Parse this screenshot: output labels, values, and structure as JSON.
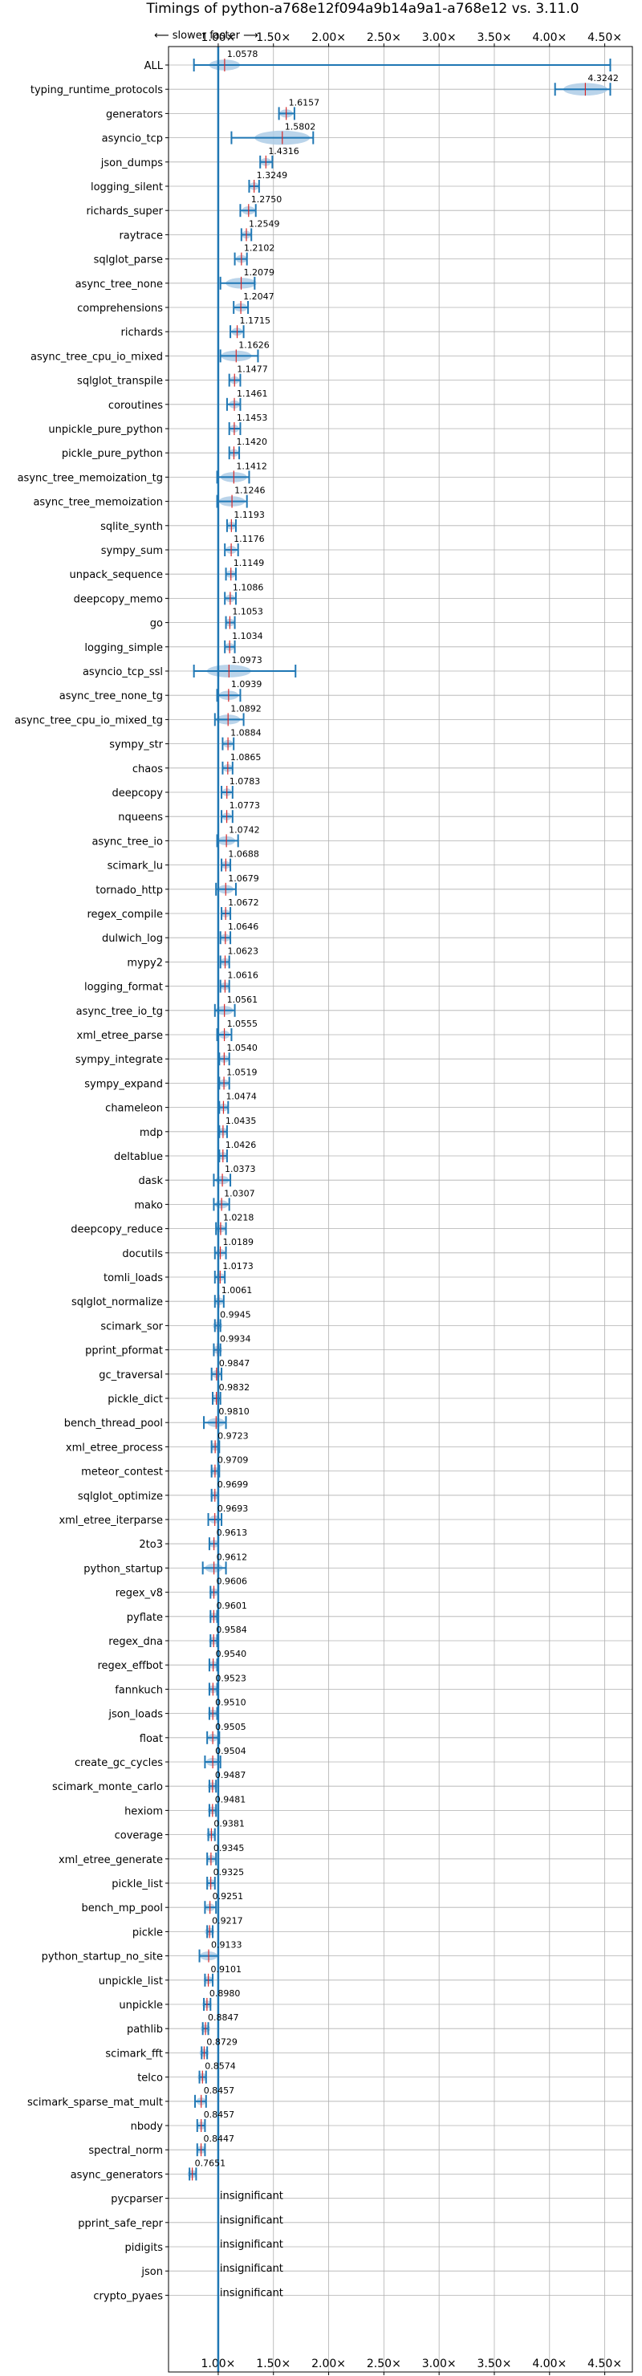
{
  "chart_data": {
    "type": "scatter",
    "title": "Timings of python-a768e12f094a9b14a9a1-a768e12 vs. 3.11.0",
    "direction_label": "⟵ slower    faster ⟶",
    "insignificant_label": "insignificant",
    "xlim": [
      0.55,
      4.75
    ],
    "x_ticks": [
      {
        "v": 1.0,
        "label": "1.00×"
      },
      {
        "v": 1.5,
        "label": "1.50×"
      },
      {
        "v": 2.0,
        "label": "2.00×"
      },
      {
        "v": 2.5,
        "label": "2.50×"
      },
      {
        "v": 3.0,
        "label": "3.00×"
      },
      {
        "v": 3.5,
        "label": "3.50×"
      },
      {
        "v": 4.0,
        "label": "4.00×"
      },
      {
        "v": 4.5,
        "label": "4.50×"
      }
    ],
    "reference_line": 1.0,
    "grid": true,
    "colors": {
      "marker": "#1f77b4",
      "violin": "#aecde6",
      "median": "#d62728",
      "grid": "#b0b0b0",
      "axis": "#000000"
    },
    "benchmarks": [
      {
        "name": "ALL",
        "value": 1.0578,
        "label": "1.0578",
        "lo": 0.78,
        "hi": 4.55,
        "w": 0.14
      },
      {
        "name": "typing_runtime_protocols",
        "value": 4.3242,
        "label": "4.3242",
        "lo": 4.05,
        "hi": 4.55,
        "w": 0.2
      },
      {
        "name": "generators",
        "value": 1.6157,
        "label": "1.6157",
        "lo": 1.55,
        "hi": 1.69,
        "w": 0.06
      },
      {
        "name": "asyncio_tcp",
        "value": 1.5802,
        "label": "1.5802",
        "lo": 1.12,
        "hi": 1.86,
        "w": 0.25
      },
      {
        "name": "json_dumps",
        "value": 1.4316,
        "label": "1.4316",
        "lo": 1.38,
        "hi": 1.49,
        "w": 0.05
      },
      {
        "name": "logging_silent",
        "value": 1.3249,
        "label": "1.3249",
        "lo": 1.28,
        "hi": 1.37,
        "w": 0.04
      },
      {
        "name": "richards_super",
        "value": 1.275,
        "label": "1.2750",
        "lo": 1.2,
        "hi": 1.34,
        "w": 0.06
      },
      {
        "name": "raytrace",
        "value": 1.2549,
        "label": "1.2549",
        "lo": 1.21,
        "hi": 1.3,
        "w": 0.04
      },
      {
        "name": "sqlglot_parse",
        "value": 1.2102,
        "label": "1.2102",
        "lo": 1.15,
        "hi": 1.26,
        "w": 0.05
      },
      {
        "name": "async_tree_none",
        "value": 1.2079,
        "label": "1.2079",
        "lo": 1.02,
        "hi": 1.33,
        "w": 0.14
      },
      {
        "name": "comprehensions",
        "value": 1.2047,
        "label": "1.2047",
        "lo": 1.14,
        "hi": 1.27,
        "w": 0.06
      },
      {
        "name": "richards",
        "value": 1.1715,
        "label": "1.1715",
        "lo": 1.11,
        "hi": 1.23,
        "w": 0.05
      },
      {
        "name": "async_tree_cpu_io_mixed",
        "value": 1.1626,
        "label": "1.1626",
        "lo": 1.02,
        "hi": 1.36,
        "w": 0.14
      },
      {
        "name": "sqlglot_transpile",
        "value": 1.1477,
        "label": "1.1477",
        "lo": 1.1,
        "hi": 1.2,
        "w": 0.04
      },
      {
        "name": "coroutines",
        "value": 1.1461,
        "label": "1.1461",
        "lo": 1.08,
        "hi": 1.2,
        "w": 0.05
      },
      {
        "name": "unpickle_pure_python",
        "value": 1.1453,
        "label": "1.1453",
        "lo": 1.1,
        "hi": 1.2,
        "w": 0.04
      },
      {
        "name": "pickle_pure_python",
        "value": 1.142,
        "label": "1.1420",
        "lo": 1.1,
        "hi": 1.19,
        "w": 0.04
      },
      {
        "name": "async_tree_memoization_tg",
        "value": 1.1412,
        "label": "1.1412",
        "lo": 0.99,
        "hi": 1.28,
        "w": 0.12
      },
      {
        "name": "async_tree_memoization",
        "value": 1.1246,
        "label": "1.1246",
        "lo": 0.99,
        "hi": 1.26,
        "w": 0.12
      },
      {
        "name": "sqlite_synth",
        "value": 1.1193,
        "label": "1.1193",
        "lo": 1.08,
        "hi": 1.16,
        "w": 0.035
      },
      {
        "name": "sympy_sum",
        "value": 1.1176,
        "label": "1.1176",
        "lo": 1.06,
        "hi": 1.18,
        "w": 0.05
      },
      {
        "name": "unpack_sequence",
        "value": 1.1149,
        "label": "1.1149",
        "lo": 1.07,
        "hi": 1.16,
        "w": 0.04
      },
      {
        "name": "deepcopy_memo",
        "value": 1.1086,
        "label": "1.1086",
        "lo": 1.06,
        "hi": 1.16,
        "w": 0.04
      },
      {
        "name": "go",
        "value": 1.1053,
        "label": "1.1053",
        "lo": 1.07,
        "hi": 1.15,
        "w": 0.035
      },
      {
        "name": "logging_simple",
        "value": 1.1034,
        "label": "1.1034",
        "lo": 1.06,
        "hi": 1.15,
        "w": 0.04
      },
      {
        "name": "asyncio_tcp_ssl",
        "value": 1.0973,
        "label": "1.0973",
        "lo": 0.78,
        "hi": 1.7,
        "w": 0.2
      },
      {
        "name": "async_tree_none_tg",
        "value": 1.0939,
        "label": "1.0939",
        "lo": 0.99,
        "hi": 1.2,
        "w": 0.09
      },
      {
        "name": "async_tree_cpu_io_mixed_tg",
        "value": 1.0892,
        "label": "1.0892",
        "lo": 0.97,
        "hi": 1.23,
        "w": 0.11
      },
      {
        "name": "sympy_str",
        "value": 1.0884,
        "label": "1.0884",
        "lo": 1.04,
        "hi": 1.14,
        "w": 0.04
      },
      {
        "name": "chaos",
        "value": 1.0865,
        "label": "1.0865",
        "lo": 1.04,
        "hi": 1.13,
        "w": 0.04
      },
      {
        "name": "deepcopy",
        "value": 1.0783,
        "label": "1.0783",
        "lo": 1.03,
        "hi": 1.13,
        "w": 0.04
      },
      {
        "name": "nqueens",
        "value": 1.0773,
        "label": "1.0773",
        "lo": 1.03,
        "hi": 1.13,
        "w": 0.04
      },
      {
        "name": "async_tree_io",
        "value": 1.0742,
        "label": "1.0742",
        "lo": 0.99,
        "hi": 1.18,
        "w": 0.08
      },
      {
        "name": "scimark_lu",
        "value": 1.0688,
        "label": "1.0688",
        "lo": 1.03,
        "hi": 1.11,
        "w": 0.035
      },
      {
        "name": "tornado_http",
        "value": 1.0679,
        "label": "1.0679",
        "lo": 0.98,
        "hi": 1.16,
        "w": 0.07
      },
      {
        "name": "regex_compile",
        "value": 1.0672,
        "label": "1.0672",
        "lo": 1.03,
        "hi": 1.11,
        "w": 0.035
      },
      {
        "name": "dulwich_log",
        "value": 1.0646,
        "label": "1.0646",
        "lo": 1.02,
        "hi": 1.11,
        "w": 0.035
      },
      {
        "name": "mypy2",
        "value": 1.0623,
        "label": "1.0623",
        "lo": 1.02,
        "hi": 1.1,
        "w": 0.035
      },
      {
        "name": "logging_format",
        "value": 1.0616,
        "label": "1.0616",
        "lo": 1.02,
        "hi": 1.1,
        "w": 0.035
      },
      {
        "name": "async_tree_io_tg",
        "value": 1.0561,
        "label": "1.0561",
        "lo": 0.97,
        "hi": 1.15,
        "w": 0.08
      },
      {
        "name": "xml_etree_parse",
        "value": 1.0555,
        "label": "1.0555",
        "lo": 0.99,
        "hi": 1.12,
        "w": 0.05
      },
      {
        "name": "sympy_integrate",
        "value": 1.054,
        "label": "1.0540",
        "lo": 1.01,
        "hi": 1.1,
        "w": 0.035
      },
      {
        "name": "sympy_expand",
        "value": 1.0519,
        "label": "1.0519",
        "lo": 1.01,
        "hi": 1.1,
        "w": 0.035
      },
      {
        "name": "chameleon",
        "value": 1.0474,
        "label": "1.0474",
        "lo": 1.01,
        "hi": 1.09,
        "w": 0.035
      },
      {
        "name": "mdp",
        "value": 1.0435,
        "label": "1.0435",
        "lo": 1.01,
        "hi": 1.08,
        "w": 0.03
      },
      {
        "name": "deltablue",
        "value": 1.0426,
        "label": "1.0426",
        "lo": 1.01,
        "hi": 1.08,
        "w": 0.03
      },
      {
        "name": "dask",
        "value": 1.0373,
        "label": "1.0373",
        "lo": 0.96,
        "hi": 1.11,
        "w": 0.06
      },
      {
        "name": "mako",
        "value": 1.0307,
        "label": "1.0307",
        "lo": 0.96,
        "hi": 1.1,
        "w": 0.06
      },
      {
        "name": "deepcopy_reduce",
        "value": 1.0218,
        "label": "1.0218",
        "lo": 0.98,
        "hi": 1.07,
        "w": 0.035
      },
      {
        "name": "docutils",
        "value": 1.0189,
        "label": "1.0189",
        "lo": 0.97,
        "hi": 1.07,
        "w": 0.04
      },
      {
        "name": "tomli_loads",
        "value": 1.0173,
        "label": "1.0173",
        "lo": 0.97,
        "hi": 1.06,
        "w": 0.035
      },
      {
        "name": "sqlglot_normalize",
        "value": 1.0061,
        "label": "1.0061",
        "lo": 0.97,
        "hi": 1.05,
        "w": 0.03
      },
      {
        "name": "scimark_sor",
        "value": 0.9945,
        "label": "0.9945",
        "lo": 0.97,
        "hi": 1.02,
        "w": 0.025
      },
      {
        "name": "pprint_pformat",
        "value": 0.9934,
        "label": "0.9934",
        "lo": 0.96,
        "hi": 1.02,
        "w": 0.025
      },
      {
        "name": "gc_traversal",
        "value": 0.9847,
        "label": "0.9847",
        "lo": 0.94,
        "hi": 1.03,
        "w": 0.04
      },
      {
        "name": "pickle_dict",
        "value": 0.9832,
        "label": "0.9832",
        "lo": 0.95,
        "hi": 1.02,
        "w": 0.025
      },
      {
        "name": "bench_thread_pool",
        "value": 0.981,
        "label": "0.9810",
        "lo": 0.87,
        "hi": 1.07,
        "w": 0.08
      },
      {
        "name": "xml_etree_process",
        "value": 0.9723,
        "label": "0.9723",
        "lo": 0.94,
        "hi": 1.01,
        "w": 0.03
      },
      {
        "name": "meteor_contest",
        "value": 0.9709,
        "label": "0.9709",
        "lo": 0.94,
        "hi": 1.01,
        "w": 0.03
      },
      {
        "name": "sqlglot_optimize",
        "value": 0.9699,
        "label": "0.9699",
        "lo": 0.94,
        "hi": 1.0,
        "w": 0.025
      },
      {
        "name": "xml_etree_iterparse",
        "value": 0.9693,
        "label": "0.9693",
        "lo": 0.91,
        "hi": 1.03,
        "w": 0.05
      },
      {
        "name": "2to3",
        "value": 0.9613,
        "label": "0.9613",
        "lo": 0.92,
        "hi": 1.0,
        "w": 0.03
      },
      {
        "name": "python_startup",
        "value": 0.9612,
        "label": "0.9612",
        "lo": 0.86,
        "hi": 1.07,
        "w": 0.08
      },
      {
        "name": "regex_v8",
        "value": 0.9606,
        "label": "0.9606",
        "lo": 0.93,
        "hi": 1.0,
        "w": 0.025
      },
      {
        "name": "pyflate",
        "value": 0.9601,
        "label": "0.9601",
        "lo": 0.93,
        "hi": 0.99,
        "w": 0.025
      },
      {
        "name": "regex_dna",
        "value": 0.9584,
        "label": "0.9584",
        "lo": 0.93,
        "hi": 0.99,
        "w": 0.025
      },
      {
        "name": "regex_effbot",
        "value": 0.954,
        "label": "0.9540",
        "lo": 0.92,
        "hi": 0.99,
        "w": 0.025
      },
      {
        "name": "fannkuch",
        "value": 0.9523,
        "label": "0.9523",
        "lo": 0.92,
        "hi": 0.99,
        "w": 0.025
      },
      {
        "name": "json_loads",
        "value": 0.951,
        "label": "0.9510",
        "lo": 0.92,
        "hi": 0.99,
        "w": 0.025
      },
      {
        "name": "float",
        "value": 0.9505,
        "label": "0.9505",
        "lo": 0.9,
        "hi": 1.01,
        "w": 0.045
      },
      {
        "name": "create_gc_cycles",
        "value": 0.9504,
        "label": "0.9504",
        "lo": 0.88,
        "hi": 1.02,
        "w": 0.06
      },
      {
        "name": "scimark_monte_carlo",
        "value": 0.9487,
        "label": "0.9487",
        "lo": 0.92,
        "hi": 0.98,
        "w": 0.025
      },
      {
        "name": "hexiom",
        "value": 0.9481,
        "label": "0.9481",
        "lo": 0.92,
        "hi": 0.98,
        "w": 0.025
      },
      {
        "name": "coverage",
        "value": 0.9381,
        "label": "0.9381",
        "lo": 0.91,
        "hi": 0.97,
        "w": 0.025
      },
      {
        "name": "xml_etree_generate",
        "value": 0.9345,
        "label": "0.9345",
        "lo": 0.9,
        "hi": 0.98,
        "w": 0.03
      },
      {
        "name": "pickle_list",
        "value": 0.9325,
        "label": "0.9325",
        "lo": 0.9,
        "hi": 0.97,
        "w": 0.025
      },
      {
        "name": "bench_mp_pool",
        "value": 0.9251,
        "label": "0.9251",
        "lo": 0.88,
        "hi": 0.98,
        "w": 0.04
      },
      {
        "name": "pickle",
        "value": 0.9217,
        "label": "0.9217",
        "lo": 0.9,
        "hi": 0.95,
        "w": 0.02
      },
      {
        "name": "python_startup_no_site",
        "value": 0.9133,
        "label": "0.9133",
        "lo": 0.83,
        "hi": 1.0,
        "w": 0.08
      },
      {
        "name": "unpickle_list",
        "value": 0.9101,
        "label": "0.9101",
        "lo": 0.88,
        "hi": 0.95,
        "w": 0.025
      },
      {
        "name": "unpickle",
        "value": 0.898,
        "label": "0.8980",
        "lo": 0.87,
        "hi": 0.93,
        "w": 0.025
      },
      {
        "name": "pathlib",
        "value": 0.8847,
        "label": "0.8847",
        "lo": 0.86,
        "hi": 0.91,
        "w": 0.02
      },
      {
        "name": "scimark_fft",
        "value": 0.8729,
        "label": "0.8729",
        "lo": 0.85,
        "hi": 0.9,
        "w": 0.02
      },
      {
        "name": "telco",
        "value": 0.8574,
        "label": "0.8574",
        "lo": 0.83,
        "hi": 0.89,
        "w": 0.02
      },
      {
        "name": "scimark_sparse_mat_mult",
        "value": 0.8457,
        "label": "0.8457",
        "lo": 0.79,
        "hi": 0.89,
        "w": 0.03
      },
      {
        "name": "nbody",
        "value": 0.8457,
        "label": "0.8457",
        "lo": 0.81,
        "hi": 0.88,
        "w": 0.02
      },
      {
        "name": "spectral_norm",
        "value": 0.8447,
        "label": "0.8447",
        "lo": 0.81,
        "hi": 0.88,
        "w": 0.02
      },
      {
        "name": "async_generators",
        "value": 0.7651,
        "label": "0.7651",
        "lo": 0.74,
        "hi": 0.8,
        "w": 0.02
      },
      {
        "name": "pycparser",
        "value": null,
        "label": ""
      },
      {
        "name": "pprint_safe_repr",
        "value": null,
        "label": ""
      },
      {
        "name": "pidigits",
        "value": null,
        "label": ""
      },
      {
        "name": "json",
        "value": null,
        "label": ""
      },
      {
        "name": "crypto_pyaes",
        "value": null,
        "label": ""
      }
    ]
  }
}
